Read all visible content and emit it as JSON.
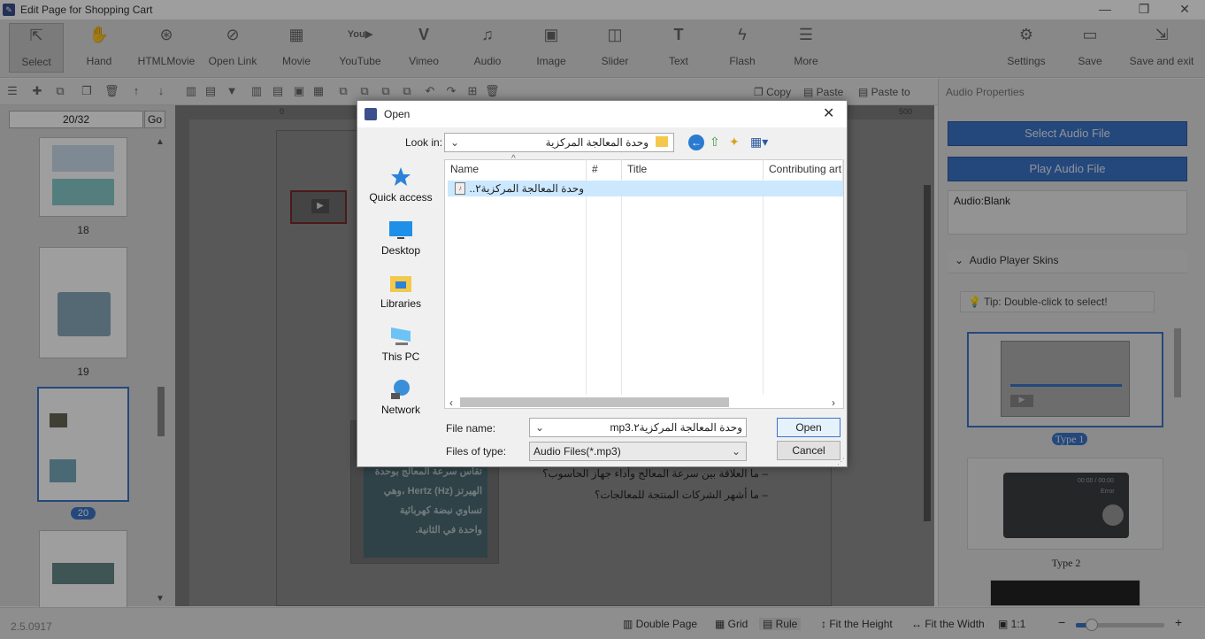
{
  "window": {
    "title": "Edit Page for Shopping Cart"
  },
  "toolbar": {
    "items": [
      {
        "label": "Select",
        "icon": "select-cursor-icon"
      },
      {
        "label": "Hand",
        "icon": "hand-icon"
      },
      {
        "label": "HTMLMovie",
        "icon": "film-reel-icon"
      },
      {
        "label": "Open Link",
        "icon": "link-icon"
      },
      {
        "label": "Movie",
        "icon": "movie-icon"
      },
      {
        "label": "YouTube",
        "icon": "youtube-icon"
      },
      {
        "label": "Vimeo",
        "icon": "vimeo-icon"
      },
      {
        "label": "Audio",
        "icon": "music-note-icon"
      },
      {
        "label": "Image",
        "icon": "image-icon"
      },
      {
        "label": "Slider",
        "icon": "slider-icon"
      },
      {
        "label": "Text",
        "icon": "text-icon"
      },
      {
        "label": "Flash",
        "icon": "flash-icon"
      },
      {
        "label": "More",
        "icon": "more-icon"
      }
    ],
    "right_items": [
      {
        "label": "Settings",
        "icon": "gear-icon"
      },
      {
        "label": "Save",
        "icon": "save-icon"
      },
      {
        "label": "Save and exit",
        "icon": "save-exit-icon"
      }
    ]
  },
  "secondary_toolbar": {
    "copy": "Copy",
    "paste": "Paste",
    "paste_to": "Paste to"
  },
  "pages": {
    "current": "20/32",
    "go_label": "Go",
    "labels": [
      "18",
      "19",
      "20"
    ]
  },
  "canvas": {
    "ruler_top_left": "0",
    "ruler_top_right": "500",
    "card_text": [
      "تقاس سرعة المعالج بوحدة",
      "الهيرتز (Hz) Hertz ،وهي",
      "تساوي نبضة كهربائية",
      "واحدة في الثانية."
    ],
    "bullets": [
      "ما العلاقة بين سرعة المعالج وأداء جهاز الحاسوب؟",
      "ما أشهر الشركات المنتجة للمعالجات؟"
    ]
  },
  "right_panel": {
    "header": "Audio Properties",
    "select_audio_button": "Select Audio File",
    "play_audio_button": "Play Audio File",
    "audio_value": "Audio:Blank",
    "skins_header": "Audio Player Skins",
    "tip": "Tip: Double-click to select!",
    "skin_labels": [
      "Type 1",
      "Type 2"
    ],
    "skin2_time": "00:00 / 00:00",
    "skin2_status": "Error"
  },
  "statusbar": {
    "version": "2.5.0917",
    "double_page": "Double Page",
    "grid": "Grid",
    "rule": "Rule",
    "fit_height": "Fit the Height",
    "fit_width": "Fit the Width",
    "one_to_one": "1:1",
    "zoom_fraction": 0.18
  },
  "dialog": {
    "title": "Open",
    "look_in_label": "Look in:",
    "look_in_value": "وحدة المعالجة المركزية",
    "places": [
      {
        "label": "Quick access",
        "icon": "star-icon"
      },
      {
        "label": "Desktop",
        "icon": "desktop-icon"
      },
      {
        "label": "Libraries",
        "icon": "library-icon"
      },
      {
        "label": "This PC",
        "icon": "computer-icon"
      },
      {
        "label": "Network",
        "icon": "network-icon"
      }
    ],
    "columns": [
      "Name",
      "#",
      "Title",
      "Contributing art"
    ],
    "files": [
      {
        "name": "وحدة المعالجة المركزية٢...."
      }
    ],
    "file_name_label": "File name:",
    "file_name_value": "وحدة المعالجة المركزية٢.mp3",
    "file_type_label": "Files of type:",
    "file_type_value": "Audio Files(*.mp3)",
    "open_button": "Open",
    "cancel_button": "Cancel"
  },
  "colors": {
    "accent": "#3b74c8",
    "selection": "#cce8ff",
    "page_badge": "#3b74c8"
  }
}
